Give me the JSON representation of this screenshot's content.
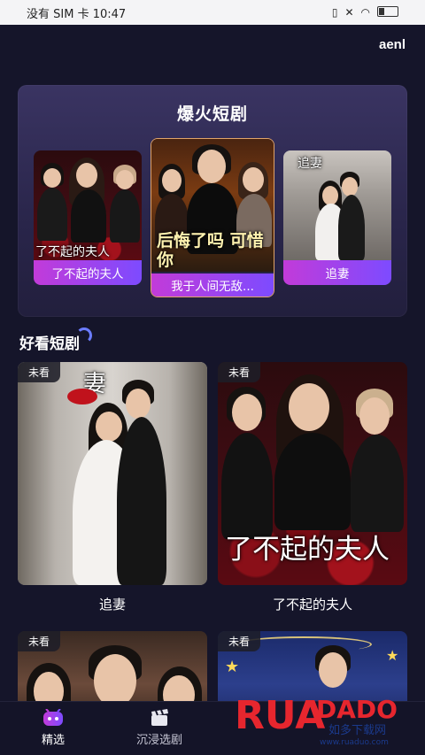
{
  "status_bar": {
    "left": "没有 SIM 卡 10:47",
    "right_icons": [
      "vibrate-icon",
      "mute-icon",
      "wifi-icon",
      "battery-icon"
    ]
  },
  "topbar": {
    "label": "aenl"
  },
  "hot_section": {
    "title": "爆火短剧",
    "items": [
      {
        "label": "了不起的夫人",
        "poster_text": "了不起的夫人"
      },
      {
        "label": "我于人间无敌...",
        "poster_text": "后悔了吗 可惜你"
      },
      {
        "label": "追妻",
        "poster_text": "追妻"
      }
    ]
  },
  "good_section": {
    "title": "好看短剧",
    "items": [
      {
        "badge": "未看",
        "title": "追妻",
        "poster_text": "妻"
      },
      {
        "badge": "未看",
        "title": "了不起的夫人",
        "poster_text": "了不起的夫人"
      },
      {
        "badge": "未看",
        "title": ""
      },
      {
        "badge": "未看",
        "title": ""
      }
    ]
  },
  "bottom_nav": {
    "items": [
      {
        "label": "精选",
        "icon": "tv-robot-icon",
        "active": true
      },
      {
        "label": "沉浸选剧",
        "icon": "clapperboard-icon",
        "active": false
      }
    ]
  },
  "watermark": {
    "brand": "RUANDADO",
    "sub1": "如多下载网",
    "sub2": "www.ruaduo.com"
  },
  "colors": {
    "background": "#15152a",
    "accent_gradient_start": "#c23bd9",
    "accent_gradient_end": "#7d4bff"
  }
}
